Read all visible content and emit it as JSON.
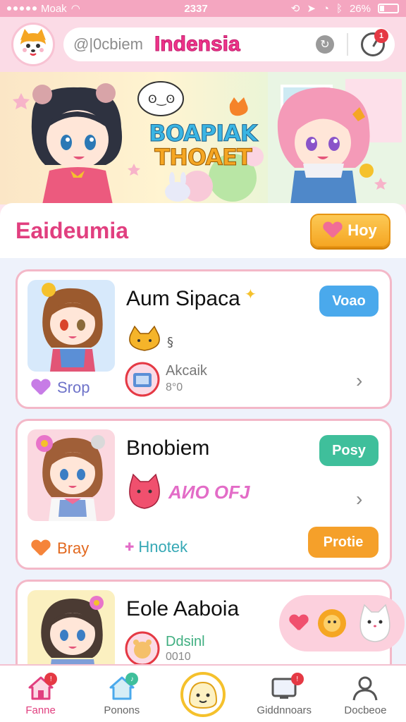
{
  "status_bar": {
    "carrier": "Moak",
    "time": "2337",
    "battery": "26%"
  },
  "header": {
    "subtitle": "@|0cbiem",
    "brand": "Indensia",
    "info_icon": "info-icon",
    "clock_icon": "clock-icon",
    "notification_count": "1"
  },
  "hero": {
    "title_line1": "BOAPIAK",
    "title_line2": "THOAET"
  },
  "section": {
    "title": "Eaideumia",
    "action_label": "Hoy"
  },
  "cards": [
    {
      "name": "Aum Sipaca",
      "tag": "Voao",
      "tag_color": "#4aa9ec",
      "meta_title": "Akcaik",
      "meta_sub": "8°0",
      "footer": "Srop"
    },
    {
      "name": "Bnobiem",
      "tag": "Posy",
      "tag_color": "#3fbf9b",
      "meta_title": "AИO OFJ",
      "footer": "Bray",
      "footer2": "Hnotek"
    },
    {
      "name": "Eole Aaboia",
      "meta_title": "Ddsinl",
      "meta_sub": "0010"
    }
  ],
  "card2_action": "Protie",
  "tabs": [
    {
      "label": "Fanne",
      "active": true
    },
    {
      "label": "Ponons",
      "active": false
    },
    {
      "label": "",
      "active": false
    },
    {
      "label": "Giddnnoars",
      "active": false
    },
    {
      "label": "Docbeoe",
      "active": false
    }
  ],
  "colors": {
    "brand_pink": "#f0338a",
    "section_title": "#e13f7f",
    "card_border": "#f3b8c8",
    "orange": "#f5a623"
  }
}
